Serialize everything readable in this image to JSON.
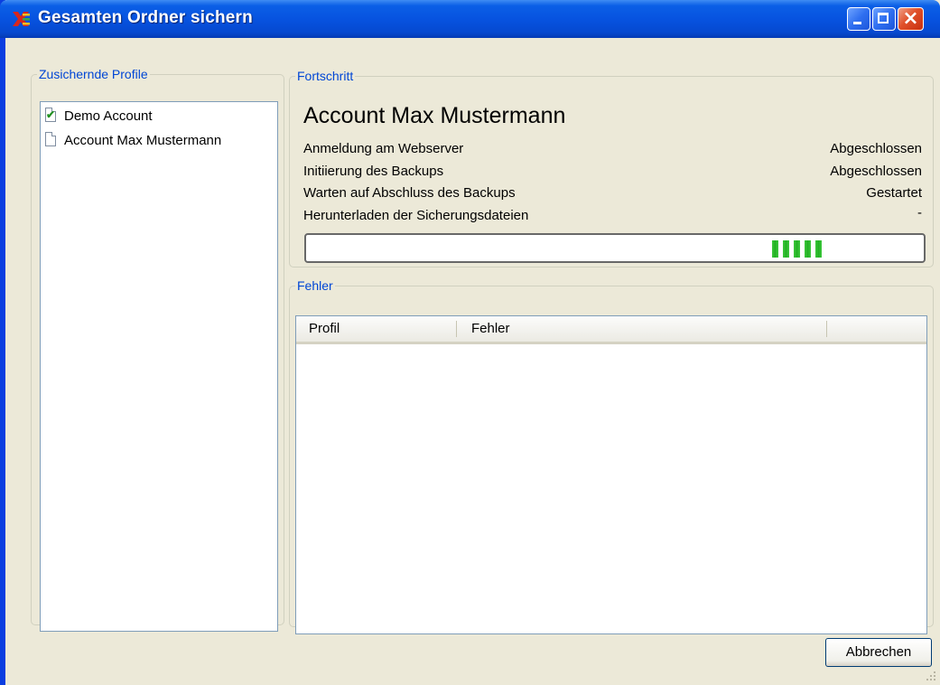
{
  "window": {
    "title": "Gesamten Ordner sichern"
  },
  "profiles": {
    "legend": "Zusichernde Profile",
    "items": [
      {
        "label": "Demo Account",
        "icon": "checked-document-icon"
      },
      {
        "label": "Account Max Mustermann",
        "icon": "document-icon"
      }
    ]
  },
  "progress": {
    "legend": "Fortschritt",
    "account": "Account Max Mustermann",
    "steps": [
      {
        "label": "Anmeldung am Webserver",
        "status": "Abgeschlossen"
      },
      {
        "label": "Initiierung des Backups",
        "status": "Abgeschlossen"
      },
      {
        "label": "Warten auf Abschluss des Backups",
        "status": "Gestartet"
      },
      {
        "label": "Herunterladen der Sicherungsdateien",
        "status": "-"
      }
    ],
    "bar_color": "#22b022"
  },
  "errors": {
    "legend": "Fehler",
    "columns": [
      "Profil",
      "Fehler"
    ]
  },
  "buttons": {
    "cancel": "Abbrechen"
  }
}
